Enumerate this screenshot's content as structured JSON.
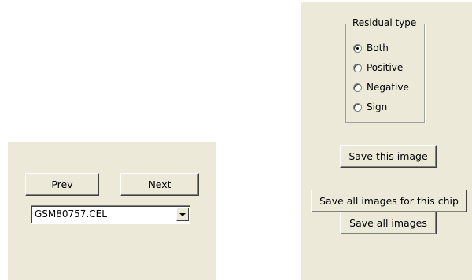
{
  "navigation": {
    "prev_label": "Prev",
    "next_label": "Next",
    "file_select": {
      "value": "GSM80757.CEL"
    }
  },
  "residual_type": {
    "title": "Residual type",
    "options": [
      {
        "label": "Both",
        "checked": true
      },
      {
        "label": "Positive",
        "checked": false
      },
      {
        "label": "Negative",
        "checked": false
      },
      {
        "label": "Sign",
        "checked": false
      }
    ]
  },
  "actions": {
    "save_this_image": "Save this image",
    "save_all_for_chip": "Save all images for this chip",
    "save_all_images": "Save all images"
  }
}
